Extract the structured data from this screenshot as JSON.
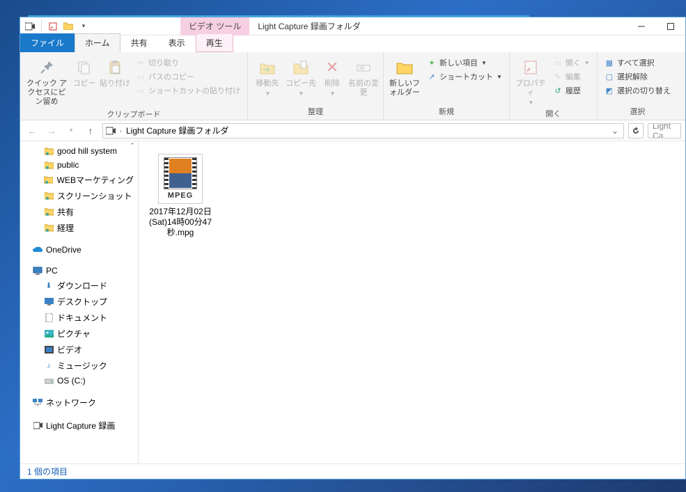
{
  "title": {
    "context_label": "ビデオ ツール",
    "window_title": "Light Capture 録画フォルダ"
  },
  "tabs": {
    "file": "ファイル",
    "home": "ホーム",
    "share": "共有",
    "view": "表示",
    "play": "再生"
  },
  "ribbon": {
    "clipboard": {
      "pin": "クイック アクセスにピン留め",
      "copy": "コピー",
      "paste": "貼り付け",
      "cut": "切り取り",
      "copy_path": "パスのコピー",
      "paste_shortcut": "ショートカットの貼り付け",
      "label": "クリップボード"
    },
    "organize": {
      "move_to": "移動先",
      "copy_to": "コピー先",
      "delete": "削除",
      "rename": "名前の変更",
      "label": "整理"
    },
    "new": {
      "new_folder": "新しいフォルダー",
      "new_item": "新しい項目",
      "shortcut": "ショートカット",
      "label": "新規"
    },
    "open": {
      "properties": "プロパティ",
      "open": "開く",
      "edit": "編集",
      "history": "履歴",
      "label": "開く"
    },
    "select": {
      "select_all": "すべて選択",
      "select_none": "選択解除",
      "invert": "選択の切り替え",
      "label": "選択"
    }
  },
  "address": {
    "crumb": "Light Capture 録画フォルダ",
    "search_placeholder": "Light Ca"
  },
  "nav": {
    "items": [
      {
        "icon": "folder-share",
        "label": "good hill system"
      },
      {
        "icon": "folder-share",
        "label": "public"
      },
      {
        "icon": "folder-share",
        "label": "WEBマーケティング"
      },
      {
        "icon": "folder-share",
        "label": "スクリーンショット"
      },
      {
        "icon": "folder-share",
        "label": "共有"
      },
      {
        "icon": "folder-share",
        "label": "経理"
      }
    ],
    "onedrive": "OneDrive",
    "pc": "PC",
    "pc_items": [
      {
        "icon": "download",
        "label": "ダウンロード"
      },
      {
        "icon": "desktop",
        "label": "デスクトップ"
      },
      {
        "icon": "document",
        "label": "ドキュメント"
      },
      {
        "icon": "picture",
        "label": "ピクチャ"
      },
      {
        "icon": "video",
        "label": "ビデオ"
      },
      {
        "icon": "music",
        "label": "ミュージック"
      },
      {
        "icon": "drive",
        "label": "OS (C:)"
      }
    ],
    "network": "ネットワーク",
    "current": "Light Capture 録画"
  },
  "files": [
    {
      "format": "MPEG",
      "name": "2017年12月02日(Sat)14時00分47秒.mpg"
    }
  ],
  "status": "1 個の項目"
}
